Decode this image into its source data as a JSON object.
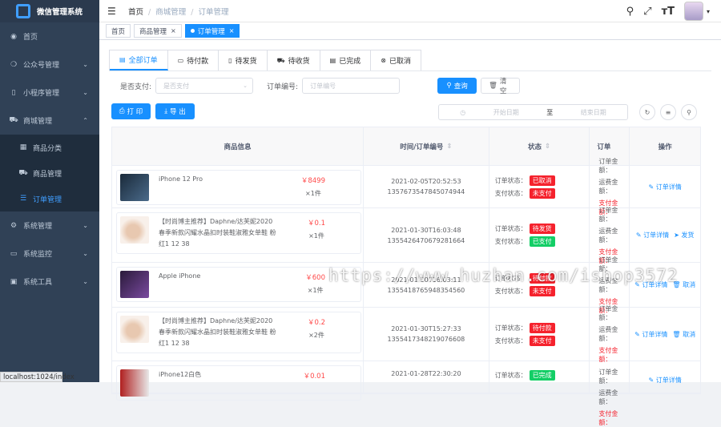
{
  "app": {
    "title": "微信管理系统"
  },
  "sidebar": {
    "items": [
      {
        "label": "首页",
        "icon": "dashboard-icon"
      },
      {
        "label": "公众号管理",
        "icon": "wechat-icon"
      },
      {
        "label": "小程序管理",
        "icon": "phone-icon"
      },
      {
        "label": "商城管理",
        "icon": "cart-icon"
      },
      {
        "label": "系统管理",
        "icon": "gear-icon"
      },
      {
        "label": "系统监控",
        "icon": "monitor-icon"
      },
      {
        "label": "系统工具",
        "icon": "toolbox-icon"
      }
    ],
    "mall_sub": [
      {
        "label": "商品分类"
      },
      {
        "label": "商品管理"
      },
      {
        "label": "订单管理"
      }
    ]
  },
  "status_url": "localhost:1024/index",
  "breadcrumb": {
    "home": "首页",
    "mall": "商城管理",
    "orders": "订单管理"
  },
  "tags": {
    "home": "首页",
    "goods": "商品管理",
    "orders": "订单管理"
  },
  "tabs": [
    {
      "label": "全部订单"
    },
    {
      "label": "待付款"
    },
    {
      "label": "待发货"
    },
    {
      "label": "待收货"
    },
    {
      "label": "已完成"
    },
    {
      "label": "已取消"
    }
  ],
  "filters": {
    "paid_label": "是否支付:",
    "paid_placeholder": "是否支付",
    "order_no_label": "订单编号:",
    "order_no_placeholder": "订单编号",
    "search": "查询",
    "reset": "清空",
    "print": "打 印",
    "export": "导 出",
    "start_date": "开始日期",
    "to": "至",
    "end_date": "结束日期"
  },
  "table": {
    "headers": {
      "goods": "商品信息",
      "time": "时间/订单编号",
      "status": "状态",
      "amount": "订单",
      "ops": "操作"
    },
    "status_label": "订单状态：",
    "pay_label": "支付状态：",
    "amount_label": "订单金额：",
    "freight_label": "运费金额：",
    "pay_amount_label": "支付金额：",
    "rows": [
      {
        "name": "iPhone 12 Pro",
        "price": "￥8499",
        "qty": "×1件",
        "time": "2021-02-05T20:52:53",
        "order_no": "1357673547845074944",
        "order_status": "已取消",
        "order_color": "red",
        "pay_status": "未支付",
        "pay_color": "red",
        "ops": [
          "订单详情"
        ]
      },
      {
        "name": "【时尚博主推荐】Daphne/达芙妮2020春季新款闪耀水晶扣时装鞋淑雅女单鞋 粉红1 12 38",
        "price": "￥0.1",
        "qty": "×1件",
        "time": "2021-01-30T16:03:48",
        "order_no": "1355426470679281664",
        "order_status": "待发货",
        "order_color": "red",
        "pay_status": "已支付",
        "pay_color": "green",
        "ops": [
          "订单详情",
          "发货"
        ]
      },
      {
        "name": "Apple iPhone",
        "price": "￥600",
        "qty": "×1件",
        "time": "2021-01-30T16:03:11",
        "order_no": "1355418765948354560",
        "order_status": "待付款",
        "order_color": "red",
        "pay_status": "未支付",
        "pay_color": "red",
        "ops": [
          "订单详情",
          "取消"
        ]
      },
      {
        "name": "【时尚博主推荐】Daphne/达芙妮2020春季新款闪耀水晶扣时装鞋淑雅女单鞋 粉红1 12 38",
        "price": "￥0.2",
        "qty": "×2件",
        "time": "2021-01-30T15:27:33",
        "order_no": "1355417348219076608",
        "order_status": "待付款",
        "order_color": "red",
        "pay_status": "未支付",
        "pay_color": "red",
        "ops": [
          "订单详情",
          "取消"
        ]
      },
      {
        "name": "iPhone12白色",
        "price": "￥0.01",
        "qty": "",
        "time": "2021-01-28T22:30:20",
        "order_no": "",
        "order_status": "已完成",
        "order_color": "green",
        "pay_status": "",
        "pay_color": "green",
        "ops": [
          "订单详情"
        ]
      }
    ]
  },
  "watermark": "https://www.huzhan.com/ishop3572"
}
